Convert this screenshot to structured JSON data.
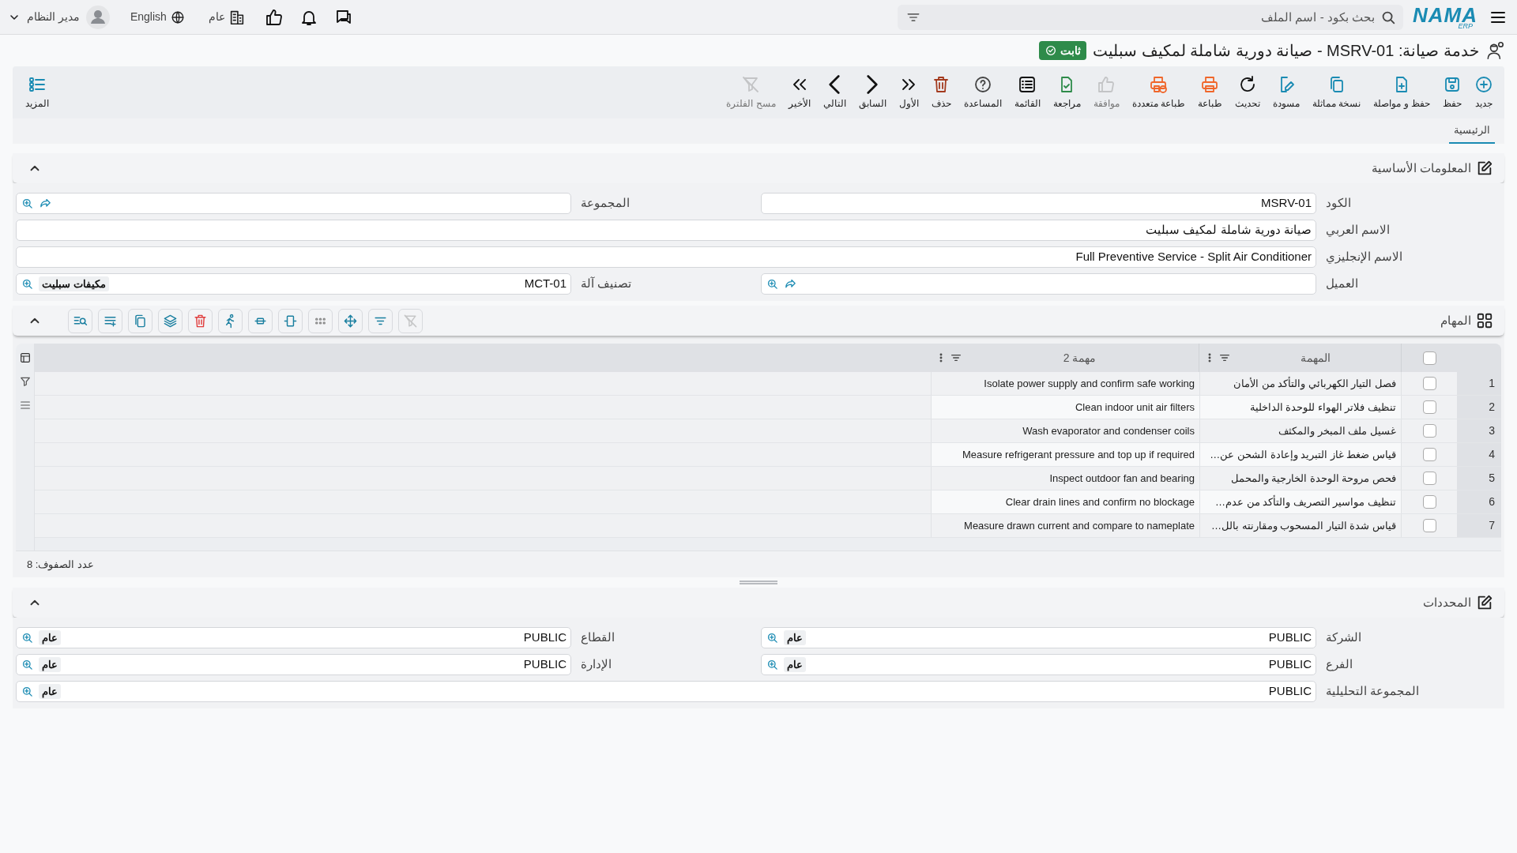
{
  "topbar": {
    "logo": {
      "name": "NAMA",
      "sub": "ERP"
    },
    "search": {
      "placeholder": "بحث بكود - اسم الملف"
    },
    "org": "عام",
    "language": "English",
    "user": "مدير النظام"
  },
  "title": {
    "text": "خدمة صيانة: MSRV-01 - صيانة دورية شاملة لمكيف سبليت",
    "status": "ثابت"
  },
  "toolbar": [
    {
      "label": "جديد",
      "disabled": false
    },
    {
      "label": "حفظ",
      "disabled": false
    },
    {
      "label": "حفظ و مواصلة",
      "disabled": false
    },
    {
      "label": "نسخة مماثلة",
      "disabled": false
    },
    {
      "label": "مسودة",
      "disabled": false
    },
    {
      "label": "تحديث",
      "disabled": false
    },
    {
      "label": "طباعة",
      "disabled": false
    },
    {
      "label": "طباعة متعددة",
      "disabled": false
    },
    {
      "label": "موافقة",
      "disabled": true
    },
    {
      "label": "مراجعة",
      "disabled": false
    },
    {
      "label": "القائمة",
      "disabled": false
    },
    {
      "label": "المساعدة",
      "disabled": false
    },
    {
      "label": "حذف",
      "disabled": false
    },
    {
      "label": "الأول",
      "disabled": false
    },
    {
      "label": "السابق",
      "disabled": false
    },
    {
      "label": "التالي",
      "disabled": false
    },
    {
      "label": "الأخير",
      "disabled": false
    },
    {
      "label": "مسح الفلترة",
      "disabled": true
    }
  ],
  "more": "المزيد",
  "tabs": [
    {
      "label": "الرئيسية",
      "selected": true
    }
  ],
  "basic": {
    "title": "المعلومات الأساسية",
    "expanded": true,
    "rows": [
      [
        {
          "label": "الكود",
          "value": "MSRV-01",
          "lookup": false
        },
        {
          "label": "المجموعة",
          "lookup": true
        }
      ],
      [
        {
          "label": "الاسم العربي",
          "value": "صيانة دورية شاملة لمكيف سبليت",
          "lookup": false
        }
      ],
      [
        {
          "label": "الاسم الإنجليزي",
          "value": "Full Preventive Service - Split Air Conditioner",
          "lookup": false
        }
      ],
      [
        {
          "label": "العميل",
          "lookup": true
        },
        {
          "label": "تصنيف آلة",
          "value": "MCT-01",
          "lookup": true,
          "tag": "مكيفات سبليت"
        }
      ]
    ]
  },
  "tasks": {
    "title": "المهام",
    "expanded": true,
    "tools": [
      {
        "disabled": true
      },
      {
        "disabled": false
      },
      {
        "disabled": false
      },
      {
        "disabled": false
      },
      {
        "disabled": false
      },
      {
        "disabled": false
      },
      {
        "disabled": false
      },
      {
        "disabled": false
      },
      {
        "disabled": false
      },
      {
        "disabled": false
      },
      {
        "disabled": false
      },
      {
        "disabled": false
      }
    ],
    "columns": [
      "المهمة",
      "مهمة 2"
    ],
    "header_checked": false,
    "rows": [
      {
        "num": "1",
        "checked": false,
        "task": "فصل التيار الكهربائي والتأكد من الأمان",
        "task2": "Isolate power supply and confirm safe working"
      },
      {
        "num": "2",
        "checked": false,
        "task": "تنظيف فلاتر الهواء للوحدة الداخلية",
        "task2": "Clean indoor unit air filters"
      },
      {
        "num": "3",
        "checked": false,
        "task": "غسيل ملف المبخر والمكثف",
        "task2": "Wash evaporator and condenser coils"
      },
      {
        "num": "4",
        "checked": false,
        "task": "قياس ضغط غاز التبريد وإعادة الشحن عن…",
        "task2": "Measure refrigerant pressure and top up if required"
      },
      {
        "num": "5",
        "checked": false,
        "task": "فحص مروحة الوحدة الخارجية والمحمل",
        "task2": "Inspect outdoor fan and bearing"
      },
      {
        "num": "6",
        "checked": false,
        "task": "تنظيف مواسير التصريف والتأكد من عدم…",
        "task2": "Clear drain lines and confirm no blockage"
      },
      {
        "num": "7",
        "checked": false,
        "task": "قياس شدة التيار المسحوب ومقارنته بالل…",
        "task2": "Measure drawn current and compare to nameplate"
      }
    ],
    "row_count": "عدد الصفوف: 8"
  },
  "dimensions": {
    "title": "المحددات",
    "expanded": true,
    "rows": [
      [
        {
          "label": "الشركة",
          "value": "PUBLIC",
          "lookup": true,
          "tag": "عام"
        },
        {
          "label": "القطاع",
          "value": "PUBLIC",
          "lookup": true,
          "tag": "عام"
        }
      ],
      [
        {
          "label": "الفرع",
          "value": "PUBLIC",
          "lookup": true,
          "tag": "عام"
        },
        {
          "label": "الإدارة",
          "value": "PUBLIC",
          "lookup": true,
          "tag": "عام"
        }
      ],
      [
        {
          "label": "المجموعة التحليلية",
          "value": "PUBLIC",
          "lookup": true,
          "tag": "عام"
        }
      ]
    ]
  }
}
